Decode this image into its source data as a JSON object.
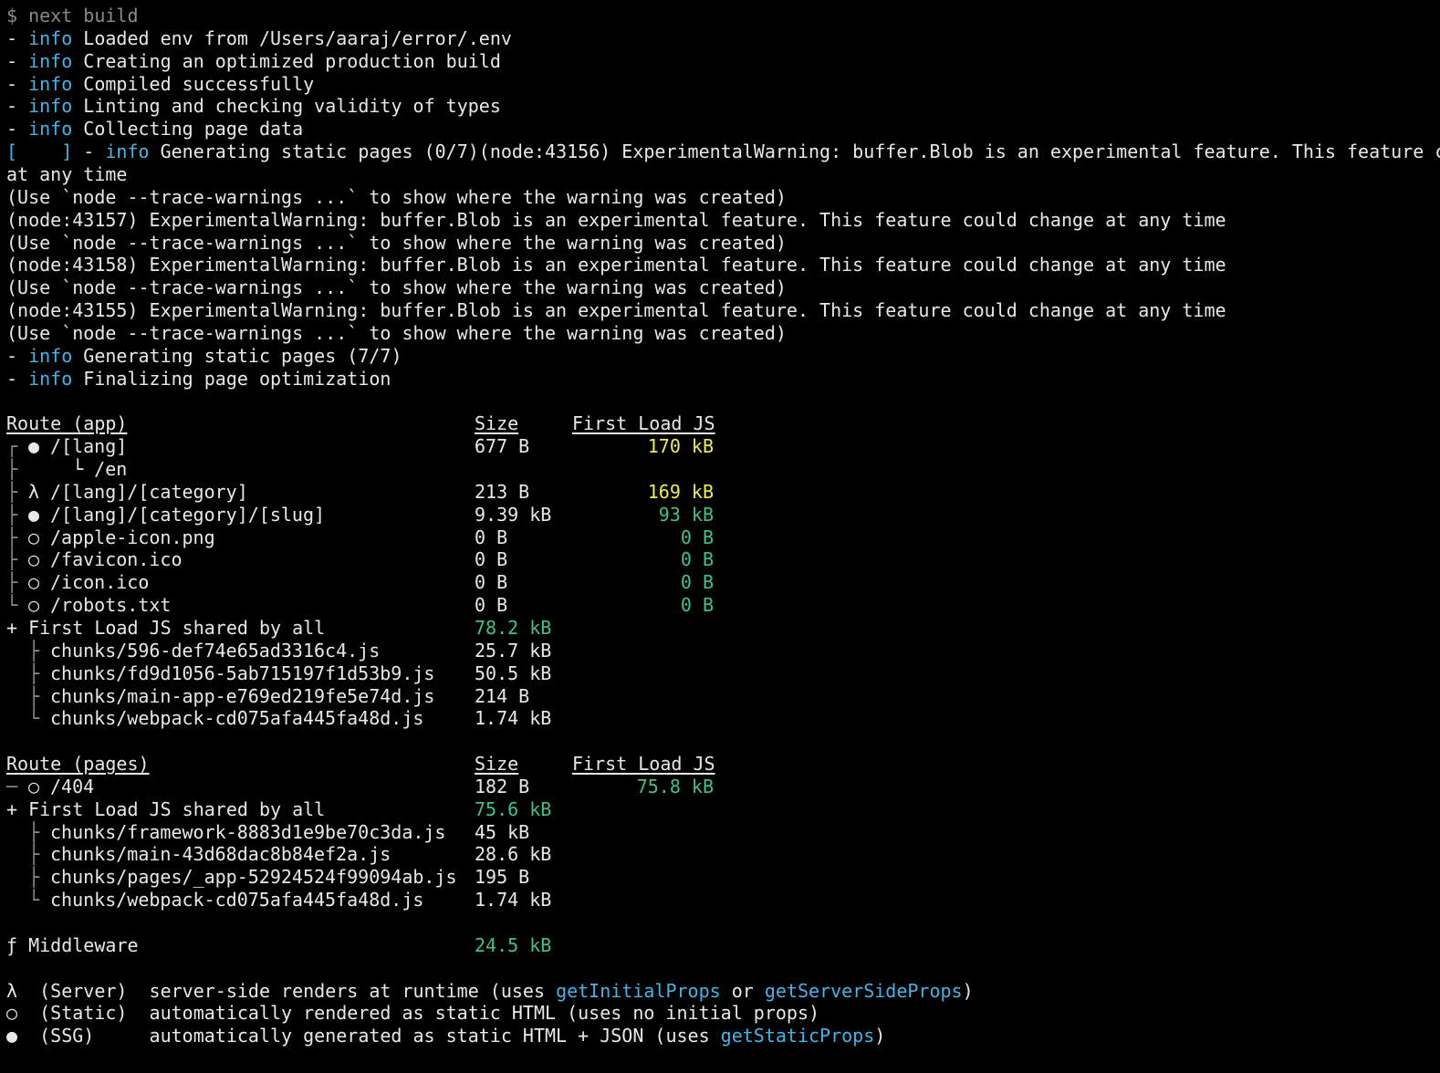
{
  "colors": {
    "background": "#000000",
    "text": "#e8e8e8",
    "info": "#45b3e6",
    "prompt": "#8a8a8a",
    "warn_size": "#f0ee4c",
    "ok_size": "#3fc28a",
    "link": "#45b3e6"
  },
  "log": [
    [
      {
        "t": "$ next build",
        "c": "dim"
      }
    ],
    [
      {
        "t": "- "
      },
      {
        "t": "info",
        "c": "info"
      },
      {
        "t": " Loaded env from /Users/aaraj/error/.env"
      }
    ],
    [
      {
        "t": "- "
      },
      {
        "t": "info",
        "c": "info"
      },
      {
        "t": " Creating an optimized production build"
      }
    ],
    [
      {
        "t": "- "
      },
      {
        "t": "info",
        "c": "info"
      },
      {
        "t": " Compiled successfully"
      }
    ],
    [
      {
        "t": "- "
      },
      {
        "t": "info",
        "c": "info"
      },
      {
        "t": " Linting and checking validity of types"
      }
    ],
    [
      {
        "t": "- "
      },
      {
        "t": "info",
        "c": "info"
      },
      {
        "t": " Collecting page data"
      }
    ],
    [
      {
        "t": "[    ]",
        "c": "info"
      },
      {
        "t": " - "
      },
      {
        "t": "info",
        "c": "info"
      },
      {
        "t": " Generating static pages (0/7)(node:43156) ExperimentalWarning: buffer.Blob is an experimental feature. This feature c"
      }
    ],
    [
      {
        "t": "at any time"
      }
    ],
    [
      {
        "t": "(Use `node --trace-warnings ...` to show where the warning was created)"
      }
    ],
    [
      {
        "t": "(node:43157) ExperimentalWarning: buffer.Blob is an experimental feature. This feature could change at any time"
      }
    ],
    [
      {
        "t": "(Use `node --trace-warnings ...` to show where the warning was created)"
      }
    ],
    [
      {
        "t": "(node:43158) ExperimentalWarning: buffer.Blob is an experimental feature. This feature could change at any time"
      }
    ],
    [
      {
        "t": "(Use `node --trace-warnings ...` to show where the warning was created)"
      }
    ],
    [
      {
        "t": "(node:43155) ExperimentalWarning: buffer.Blob is an experimental feature. This feature could change at any time"
      }
    ],
    [
      {
        "t": "(Use `node --trace-warnings ...` to show where the warning was created)"
      }
    ],
    [
      {
        "t": "- "
      },
      {
        "t": "info",
        "c": "info"
      },
      {
        "t": " Generating static pages (7/7)"
      }
    ],
    [
      {
        "t": "- "
      },
      {
        "t": "info",
        "c": "info"
      },
      {
        "t": " Finalizing page optimization"
      }
    ]
  ],
  "tables": [
    {
      "title": "Route (app)",
      "size_header": "Size",
      "first_load_header": "First Load JS",
      "rows": [
        {
          "tree": "┌",
          "sym": "●",
          "route": "/[lang]",
          "size": "677 B",
          "size_color": "",
          "first": "170 kB",
          "first_color": "yellow"
        },
        {
          "tree": "├",
          "sym": "",
          "route": "  └ /en",
          "size": "",
          "size_color": "",
          "first": "",
          "first_color": ""
        },
        {
          "tree": "├",
          "sym": "λ",
          "route": "/[lang]/[category]",
          "size": "213 B",
          "size_color": "",
          "first": "169 kB",
          "first_color": "yellow"
        },
        {
          "tree": "├",
          "sym": "●",
          "route": "/[lang]/[category]/[slug]",
          "size": "9.39 kB",
          "size_color": "",
          "first": "93 kB",
          "first_color": "green"
        },
        {
          "tree": "├",
          "sym": "○",
          "route": "/apple-icon.png",
          "size": "0 B",
          "size_color": "",
          "first": "0 B",
          "first_color": "green"
        },
        {
          "tree": "├",
          "sym": "○",
          "route": "/favicon.ico",
          "size": "0 B",
          "size_color": "",
          "first": "0 B",
          "first_color": "green"
        },
        {
          "tree": "├",
          "sym": "○",
          "route": "/icon.ico",
          "size": "0 B",
          "size_color": "",
          "first": "0 B",
          "first_color": "green"
        },
        {
          "tree": "└",
          "sym": "○",
          "route": "/robots.txt",
          "size": "0 B",
          "size_color": "",
          "first": "0 B",
          "first_color": "green"
        }
      ],
      "shared_label": "+ First Load JS shared by all",
      "shared_size": "78.2 kB",
      "chunks": [
        {
          "tree": "├",
          "name": "chunks/596-def74e65ad3316c4.js",
          "size": "25.7 kB"
        },
        {
          "tree": "├",
          "name": "chunks/fd9d1056-5ab715197f1d53b9.js",
          "size": "50.5 kB"
        },
        {
          "tree": "├",
          "name": "chunks/main-app-e769ed219fe5e74d.js",
          "size": "214 B"
        },
        {
          "tree": "└",
          "name": "chunks/webpack-cd075afa445fa48d.js",
          "size": "1.74 kB"
        }
      ]
    },
    {
      "title": "Route (pages)",
      "size_header": "Size",
      "first_load_header": "First Load JS",
      "rows": [
        {
          "tree": "─",
          "sym": "○",
          "route": "/404",
          "size": "182 B",
          "size_color": "",
          "first": "75.8 kB",
          "first_color": "green"
        }
      ],
      "shared_label": "+ First Load JS shared by all",
      "shared_size": "75.6 kB",
      "chunks": [
        {
          "tree": "├",
          "name": "chunks/framework-8883d1e9be70c3da.js",
          "size": "45 kB"
        },
        {
          "tree": "├",
          "name": "chunks/main-43d68dac8b84ef2a.js",
          "size": "28.6 kB"
        },
        {
          "tree": "├",
          "name": "chunks/pages/_app-52924524f99094ab.js",
          "size": "195 B"
        },
        {
          "tree": "└",
          "name": "chunks/webpack-cd075afa445fa48d.js",
          "size": "1.74 kB"
        }
      ]
    }
  ],
  "middleware": {
    "label": "ƒ Middleware",
    "size": "24.5 kB"
  },
  "legend": [
    [
      {
        "t": "λ  (Server)  server-side renders at runtime (uses "
      },
      {
        "t": "getInitialProps",
        "c": "link"
      },
      {
        "t": " or "
      },
      {
        "t": "getServerSideProps",
        "c": "link"
      },
      {
        "t": ")"
      }
    ],
    [
      {
        "t": "○  (Static)  automatically rendered as static HTML (uses no initial props)"
      }
    ],
    [
      {
        "t": "●  (SSG)     automatically generated as static HTML + JSON (uses "
      },
      {
        "t": "getStaticProps",
        "c": "link"
      },
      {
        "t": ")"
      }
    ]
  ]
}
